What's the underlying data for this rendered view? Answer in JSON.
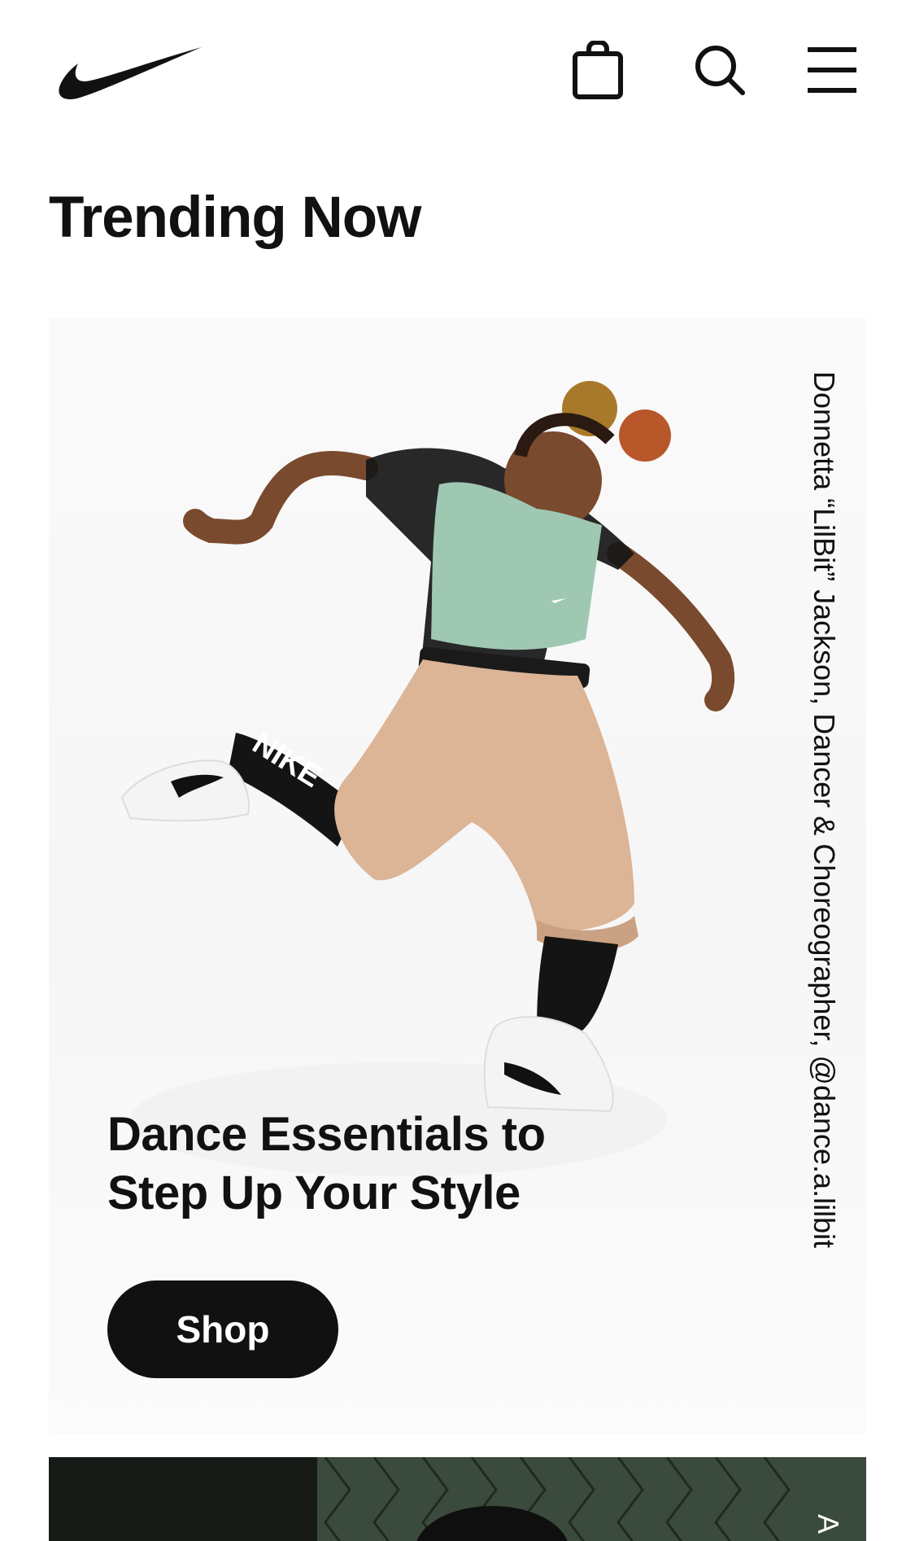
{
  "brand": {
    "logo": "swoosh-logo"
  },
  "header": {
    "icons": [
      "bag-icon",
      "search-icon",
      "menu-icon"
    ]
  },
  "section": {
    "title": "Trending Now"
  },
  "cards": [
    {
      "credit": "Donnetta “LilBit” Jackson, Dancer & Choreographer, @dance.a.lilbit",
      "headline": "Dance Essentials to Step Up Your Style",
      "cta": "Shop"
    },
    {
      "credit": "A"
    }
  ],
  "colors": {
    "text": "#111111",
    "button_bg": "#111111",
    "button_text": "#ffffff",
    "background": "#ffffff",
    "sports_bra": "#9fc8b2",
    "pants": "#dcb496"
  }
}
